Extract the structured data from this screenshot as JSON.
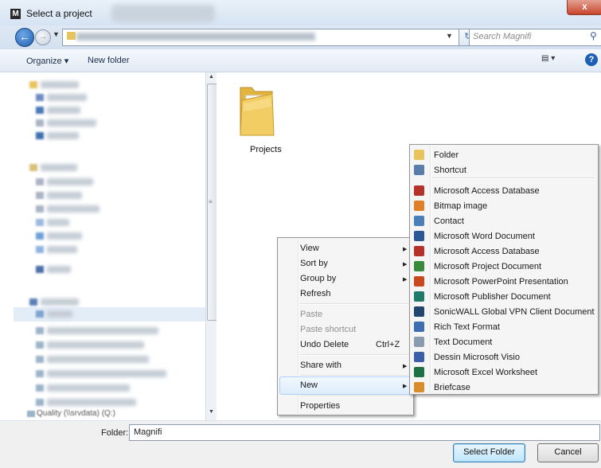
{
  "window": {
    "title": "Select a project",
    "app_icon": "M",
    "close_label": "x"
  },
  "address_bar": {
    "search_placeholder": "Search Magnifi"
  },
  "toolbar": {
    "organize_label": "Organize ▾",
    "new_folder_label": "New folder"
  },
  "content": {
    "folder_name": "Projects"
  },
  "nav_pane": {
    "last_item": "Quality (\\\\srvdata) (Q:)"
  },
  "context_menu": {
    "items": {
      "view": "View",
      "sort_by": "Sort by",
      "group_by": "Group by",
      "refresh": "Refresh",
      "paste": "Paste",
      "paste_shortcut": "Paste shortcut",
      "undo_delete": "Undo Delete",
      "undo_shortcut": "Ctrl+Z",
      "share_with": "Share with",
      "new": "New",
      "properties": "Properties"
    }
  },
  "new_submenu": {
    "items": [
      {
        "label": "Folder",
        "icon": "folder-icon",
        "color": "#e8c45c"
      },
      {
        "label": "Shortcut",
        "icon": "shortcut-icon",
        "color": "#5a7ca8"
      },
      {
        "label": "Microsoft Access Database",
        "icon": "access-icon",
        "color": "#b5322b"
      },
      {
        "label": "Bitmap image",
        "icon": "paint-icon",
        "color": "#e07f2a"
      },
      {
        "label": "Contact",
        "icon": "contact-icon",
        "color": "#4b7fb8"
      },
      {
        "label": "Microsoft Word Document",
        "icon": "word-icon",
        "color": "#2b5797"
      },
      {
        "label": "Microsoft Access Database",
        "icon": "access-icon",
        "color": "#b5322b"
      },
      {
        "label": "Microsoft Project Document",
        "icon": "project-icon",
        "color": "#3b8a3b"
      },
      {
        "label": "Microsoft PowerPoint Presentation",
        "icon": "powerpoint-icon",
        "color": "#c9491f"
      },
      {
        "label": "Microsoft Publisher Document",
        "icon": "publisher-icon",
        "color": "#1f7a6a"
      },
      {
        "label": "SonicWALL Global VPN Client Document",
        "icon": "vpn-icon",
        "color": "#23466e"
      },
      {
        "label": "Rich Text Format",
        "icon": "rtf-icon",
        "color": "#3f6fb0"
      },
      {
        "label": "Text Document",
        "icon": "text-icon",
        "color": "#8a9bb0"
      },
      {
        "label": "Dessin Microsoft Visio",
        "icon": "visio-icon",
        "color": "#3a5fa8"
      },
      {
        "label": "Microsoft Excel Worksheet",
        "icon": "excel-icon",
        "color": "#1e7145"
      },
      {
        "label": "Briefcase",
        "icon": "briefcase-icon",
        "color": "#d98c2a"
      }
    ]
  },
  "footer": {
    "folder_label": "Folder:",
    "folder_value": "Magnifi",
    "select_button": "Select Folder",
    "cancel_button": "Cancel"
  }
}
